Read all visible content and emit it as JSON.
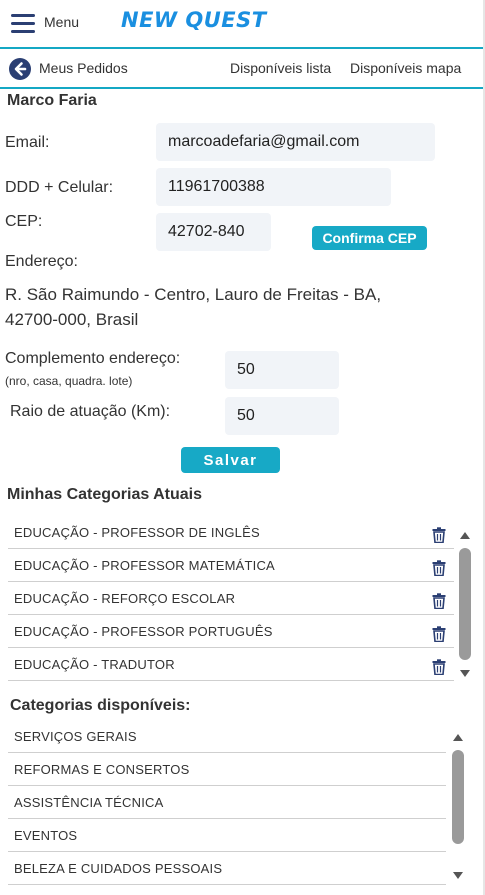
{
  "header": {
    "menu_label": "Menu",
    "brand": "NEW QUEST"
  },
  "nav": {
    "back_label": "Meus Pedidos",
    "link_list": "Disponíveis lista",
    "link_map": "Disponíveis mapa"
  },
  "profile": {
    "name": "Marco Faria",
    "email_label": "Email:",
    "email_value": "marcoadefaria@gmail.com",
    "phone_label": "DDD + Celular:",
    "phone_value": "11961700388",
    "cep_label": "CEP:",
    "cep_value": "42702-840",
    "confirm_cep_label": "Confirma CEP",
    "address_label": "Endereço:",
    "address_value": "R. São Raimundo - Centro, Lauro de Freitas - BA, 42700-000, Brasil",
    "complement_label": "Complemento endereço:",
    "complement_hint": "(nro, casa, quadra. lote)",
    "complement_value": "50",
    "radius_label": "Raio de atuação (Km):",
    "radius_value": "50",
    "save_label": "Salvar"
  },
  "current_categories": {
    "title": "Minhas Categorias Atuais",
    "items": [
      "EDUCAÇÃO -  PROFESSOR DE INGLÊS",
      "EDUCAÇÃO -  PROFESSOR MATEMÁTICA",
      "EDUCAÇÃO -  REFORÇO ESCOLAR",
      "EDUCAÇÃO -  PROFESSOR PORTUGUÊS",
      "EDUCAÇÃO -  TRADUTOR"
    ]
  },
  "available_categories": {
    "title": "Categorias disponíveis:",
    "items": [
      "SERVIÇOS GERAIS",
      "REFORMAS E CONSERTOS",
      "ASSISTÊNCIA TÉCNICA",
      "EVENTOS",
      "BELEZA E CUIDADOS PESSOAIS"
    ]
  },
  "colors": {
    "accent": "#17a9c6",
    "brand": "#1a8fe0",
    "icon": "#2b3f73"
  },
  "icons": {
    "menu": "hamburger-icon",
    "back": "arrow-left-circle-icon",
    "delete": "trash-icon"
  }
}
